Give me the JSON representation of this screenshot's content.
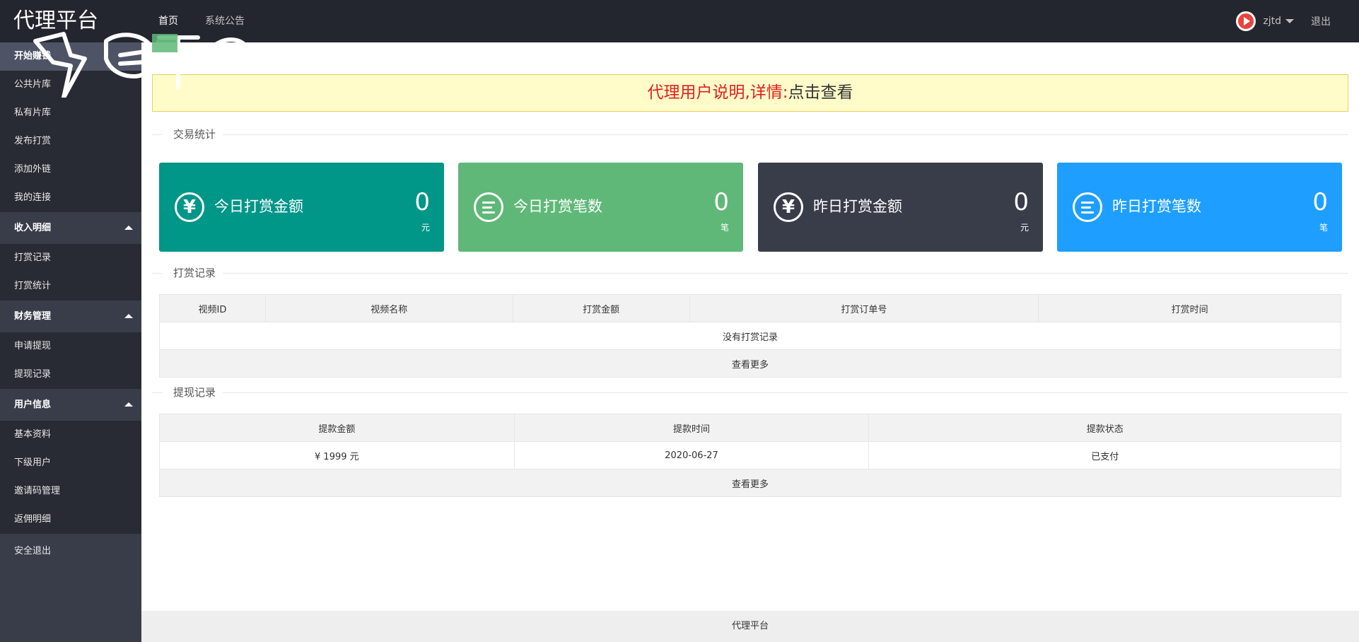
{
  "header": {
    "logo": "代理平台",
    "nav": [
      "首页",
      "系统公告"
    ],
    "username": "zjtd",
    "logout": "退出"
  },
  "sidebar": {
    "top_item": "开始赚钱",
    "items_1": [
      "公共片库",
      "私有片库",
      "发布打赏",
      "添加外链",
      "我的连接"
    ],
    "group_income": "收入明细",
    "items_income": [
      "打赏记录",
      "打赏统计"
    ],
    "group_finance": "财务管理",
    "items_finance": [
      "申请提现",
      "提现记录"
    ],
    "group_user": "用户信息",
    "items_user": [
      "基本资料",
      "下级用户",
      "邀请码管理",
      "返佣明细"
    ],
    "exit": "安全退出"
  },
  "notice": {
    "text": "代理用户说明,详情:",
    "link": "点击查看"
  },
  "sections": {
    "stats": "交易统计",
    "tips": "打赏记录",
    "withdraw": "提现记录"
  },
  "cards": [
    {
      "title": "今日打赏金额",
      "value": "0",
      "unit": "元",
      "color": "#009688",
      "icon": "yen-icon"
    },
    {
      "title": "今日打赏笔数",
      "value": "0",
      "unit": "笔",
      "color": "#5fb878",
      "icon": "list-icon"
    },
    {
      "title": "昨日打赏金额",
      "value": "0",
      "unit": "元",
      "color": "#393d49",
      "icon": "yen-icon"
    },
    {
      "title": "昨日打赏笔数",
      "value": "0",
      "unit": "笔",
      "color": "#1e9fff",
      "icon": "list-icon"
    }
  ],
  "tips_table": {
    "headers": [
      "视频ID",
      "视频名称",
      "打赏金额",
      "打赏订单号",
      "打赏时间"
    ],
    "empty": "没有打赏记录",
    "more": "查看更多"
  },
  "withdraw_table": {
    "headers": [
      "提款金额",
      "提款时间",
      "提款状态"
    ],
    "rows": [
      [
        "¥ 1999 元",
        "2020-06-27",
        "已支付"
      ]
    ],
    "more": "查看更多"
  },
  "footer": "代理平台"
}
